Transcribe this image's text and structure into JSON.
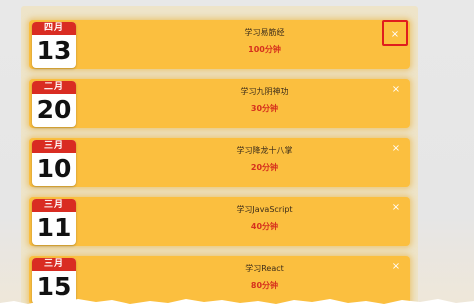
{
  "tasks": [
    {
      "month": "四月",
      "day": "13",
      "title": "学习易筋经",
      "duration": "100分钟",
      "close": "×"
    },
    {
      "month": "二月",
      "day": "20",
      "title": "学习九阴神功",
      "duration": "30分钟",
      "close": "×"
    },
    {
      "month": "三月",
      "day": "10",
      "title": "学习降龙十八掌",
      "duration": "20分钟",
      "close": "×"
    },
    {
      "month": "三月",
      "day": "11",
      "title": "学习JavaScript",
      "duration": "40分钟",
      "close": "×"
    },
    {
      "month": "三月",
      "day": "15",
      "title": "学习React",
      "duration": "80分钟",
      "close": "×"
    }
  ],
  "colors": {
    "card": "#fbbf3f",
    "calendar_header": "#d92c22",
    "duration_text": "#d6301d",
    "highlight": "#e01d1d"
  },
  "icons": {
    "remove": "close-icon",
    "date": "calendar-icon"
  }
}
